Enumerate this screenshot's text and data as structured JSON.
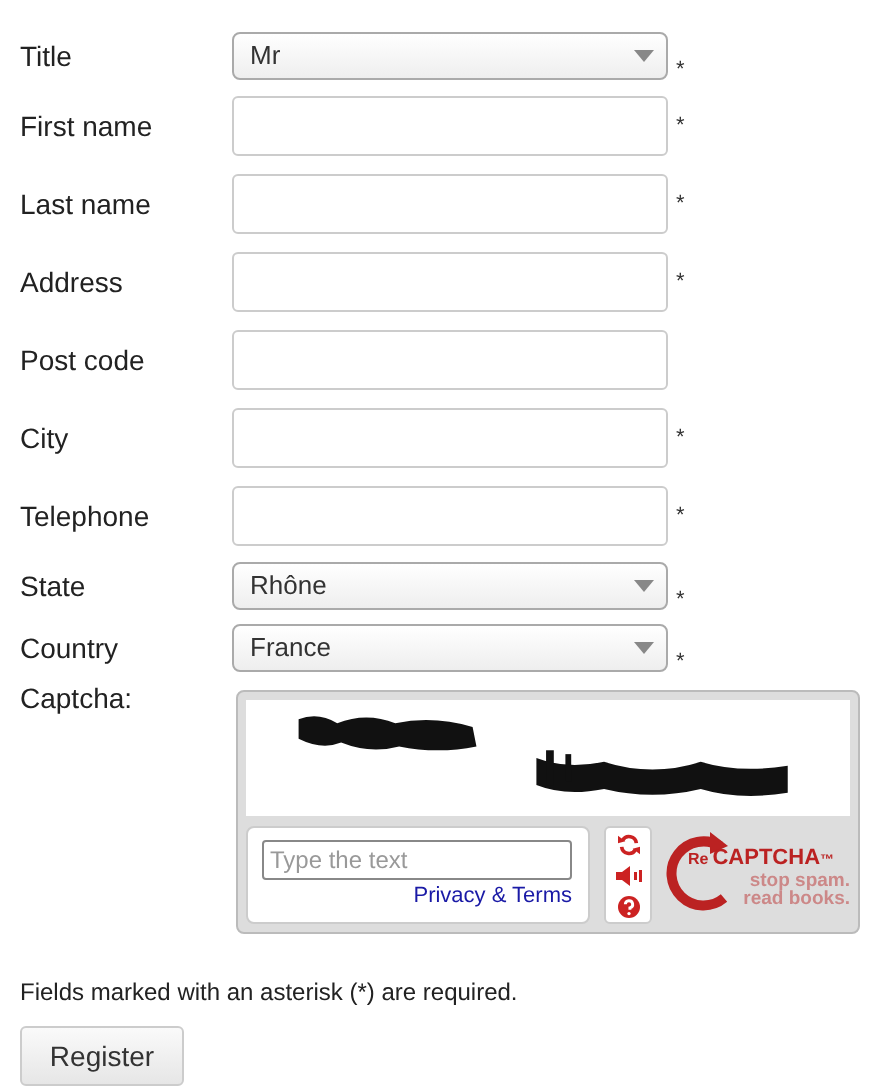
{
  "fields": [
    {
      "label": "Title",
      "kind": "select",
      "value": "Mr",
      "required": true
    },
    {
      "label": "First name",
      "kind": "input",
      "required": true
    },
    {
      "label": "Last name",
      "kind": "input",
      "required": true
    },
    {
      "label": "Address",
      "kind": "input",
      "required": true
    },
    {
      "label": "Post code",
      "kind": "input",
      "required": false
    },
    {
      "label": "City",
      "kind": "input",
      "required": true
    },
    {
      "label": "Telephone",
      "kind": "input",
      "required": true
    },
    {
      "label": "State",
      "kind": "select",
      "value": "Rhône",
      "required": true
    },
    {
      "label": "Country",
      "kind": "select",
      "value": "France",
      "required": true
    }
  ],
  "required_mark": "*",
  "captcha": {
    "label": "Captcha:",
    "placeholder": "Type the text",
    "link": "Privacy & Terms",
    "logo_prefix": "Re",
    "logo_name": "CAPTCHA",
    "logo_mark": "™",
    "tagline": [
      "stop spam.",
      "read books."
    ]
  },
  "note": "Fields marked with an asterisk (*) are required.",
  "submit": "Register"
}
